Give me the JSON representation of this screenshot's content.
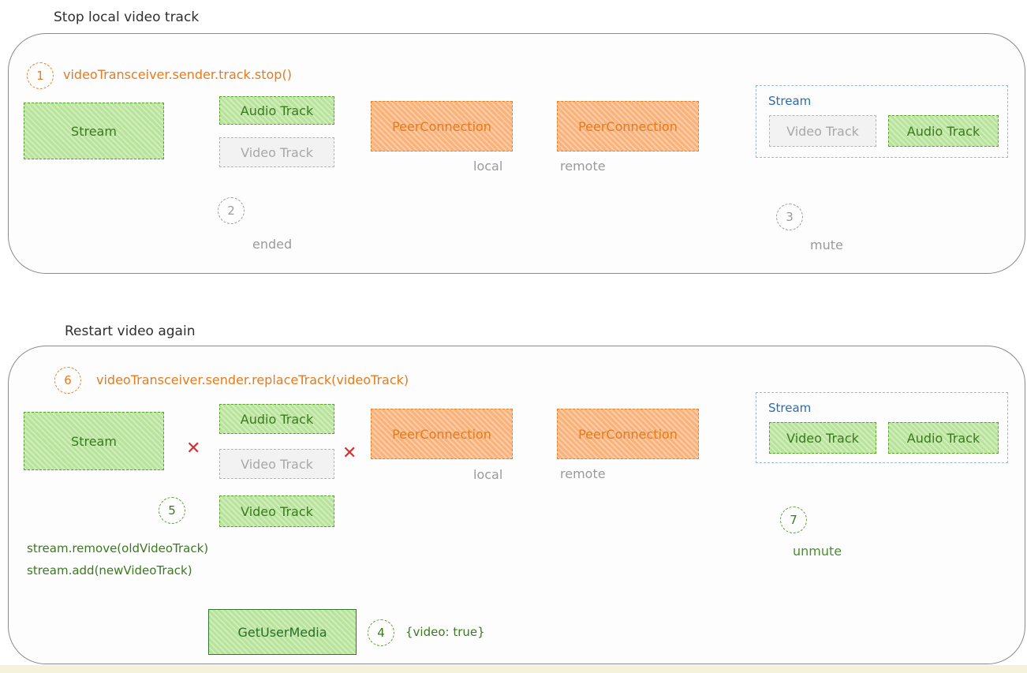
{
  "section1": {
    "title": "Stop local video track",
    "step1": {
      "number": "1",
      "code": "videoTransceiver.sender.track.stop()"
    },
    "stream_label": "Stream",
    "audio_track": "Audio Track",
    "video_track": "Video Track",
    "peer_local": "PeerConnection",
    "peer_remote": "PeerConnection",
    "local_label": "local",
    "remote_label": "remote",
    "remote_stream_label": "Stream",
    "remote_video_track": "Video Track",
    "remote_audio_track": "Audio Track",
    "step2": {
      "number": "2",
      "label": "ended"
    },
    "step3": {
      "number": "3",
      "label": "mute"
    }
  },
  "section2": {
    "title": "Restart video again",
    "step6": {
      "number": "6",
      "code": "videoTransceiver.sender.replaceTrack(videoTrack)"
    },
    "stream_label": "Stream",
    "audio_track": "Audio Track",
    "old_video_track": "Video Track",
    "new_video_track": "Video Track",
    "peer_local": "PeerConnection",
    "peer_remote": "PeerConnection",
    "local_label": "local",
    "remote_label": "remote",
    "remote_stream_label": "Stream",
    "remote_video_track": "Video Track",
    "remote_audio_track": "Audio Track",
    "step5": {
      "number": "5",
      "code_line1": "stream.remove(oldVideoTrack)",
      "code_line2": "stream.add(newVideoTrack)"
    },
    "step7": {
      "number": "7",
      "label": "unmute"
    },
    "step4": {
      "number": "4",
      "label": "{video: true}"
    },
    "gum": "GetUserMedia",
    "x_marks": [
      "✕",
      "✕"
    ]
  },
  "colors": {
    "green": "#5aa02c",
    "orange": "#e8822a",
    "grey": "#b5b5b5",
    "blue": "#2b6cb0",
    "red": "#d32f2f"
  }
}
